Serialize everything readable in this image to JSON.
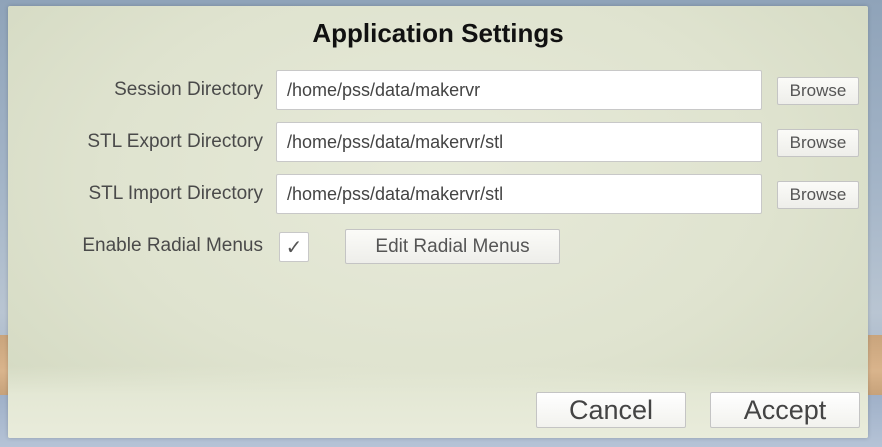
{
  "dialog": {
    "title": "Application Settings"
  },
  "settings": [
    {
      "label": "Session Directory",
      "value": "/home/pss/data/makervr",
      "browse_label": "Browse"
    },
    {
      "label": "STL Export Directory",
      "value": "/home/pss/data/makervr/stl",
      "browse_label": "Browse"
    },
    {
      "label": "STL Import Directory",
      "value": "/home/pss/data/makervr/stl",
      "browse_label": "Browse"
    }
  ],
  "radial": {
    "label": "Enable Radial Menus",
    "checked": true,
    "check_glyph": "✓",
    "edit_label": "Edit Radial Menus"
  },
  "footer": {
    "cancel_label": "Cancel",
    "accept_label": "Accept"
  }
}
